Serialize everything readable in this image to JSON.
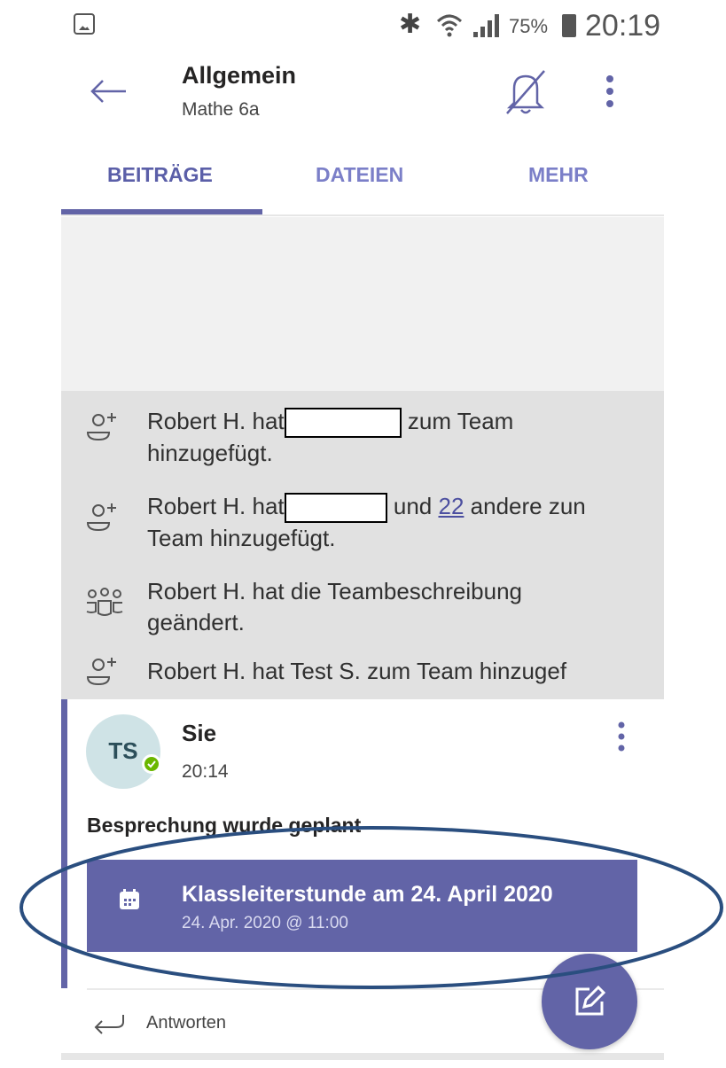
{
  "status_bar": {
    "battery": "75%",
    "time": "20:19"
  },
  "header": {
    "channel_title": "Allgemein",
    "team_name": "Mathe 6a"
  },
  "tabs": [
    {
      "label": "BEITRÄGE",
      "active": true
    },
    {
      "label": "DATEIEN",
      "active": false
    },
    {
      "label": "MEHR",
      "active": false
    }
  ],
  "activity": [
    {
      "icon": "add-person-icon",
      "part1": "Robert H. hat",
      "part2": "zum Team",
      "line2": "hinzugefügt."
    },
    {
      "icon": "add-person-icon",
      "part1": "Robert H. hat",
      "part2": "und",
      "link": "22",
      "part3": "andere zun",
      "line2": "Team hinzugefügt."
    },
    {
      "icon": "team-icon",
      "line1": "Robert H. hat die Teambeschreibung",
      "line2": "geändert."
    },
    {
      "icon": "add-person-icon",
      "line1": "Robert H. hat Test S. zum Team hinzugef"
    }
  ],
  "post": {
    "avatar_initials": "TS",
    "author": "Sie",
    "time": "20:14",
    "subject": "Besprechung wurde geplant",
    "meeting": {
      "title": "Klassleiterstunde am 24. April 2020",
      "datetime": "24. Apr. 2020 @ 11:00"
    },
    "reply_label": "Antworten"
  },
  "colors": {
    "accent": "#6264A7",
    "presence": "#6bb700",
    "annotation": "#2a4e7f"
  }
}
